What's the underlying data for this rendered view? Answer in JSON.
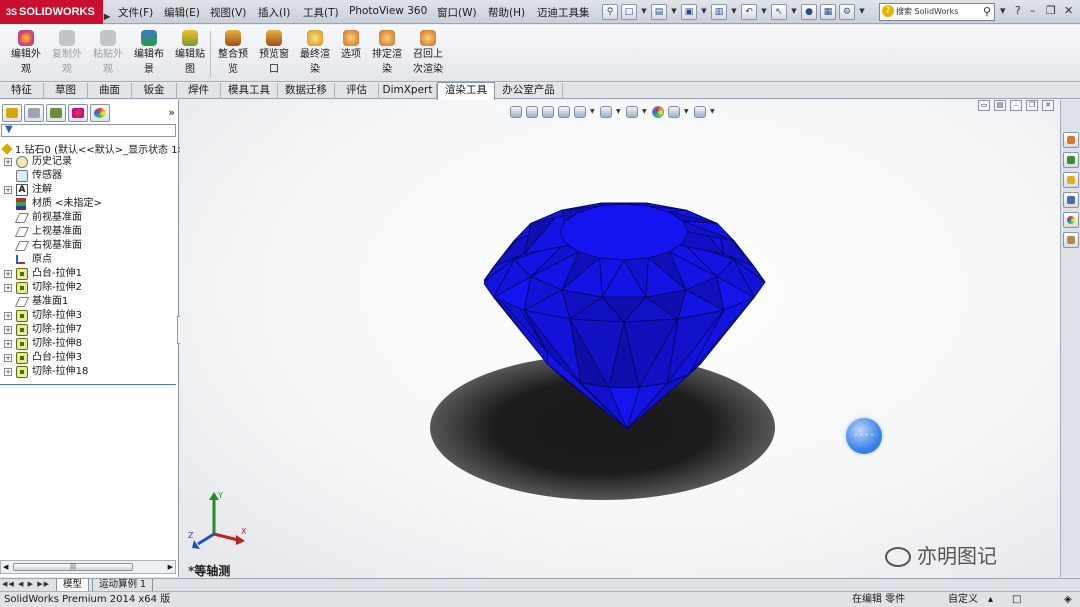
{
  "app": {
    "brand": "SOLIDWORKS",
    "brand_prefix": "3S",
    "menus": [
      "文件(F)",
      "编辑(E)",
      "视图(V)",
      "插入(I)",
      "工具(T)",
      "PhotoView 360",
      "窗口(W)",
      "帮助(H)",
      "迈迪工具集"
    ],
    "search_placeholder": "搜索 SolidWorks",
    "search_help_icon": "?"
  },
  "toolbar": {
    "buttons": [
      {
        "label_1": "编辑外",
        "label_2": "观",
        "enabled": true,
        "icon": "edit-appearance-icon",
        "color": "#e23a6a"
      },
      {
        "label_1": "复制外",
        "label_2": "观",
        "enabled": false,
        "icon": "copy-appearance-icon",
        "color": "#a6adb6"
      },
      {
        "label_1": "粘贴外",
        "label_2": "观",
        "enabled": false,
        "icon": "paste-appearance-icon",
        "color": "#a6adb6"
      },
      {
        "label_1": "编辑布",
        "label_2": "景",
        "enabled": true,
        "icon": "edit-scene-icon",
        "color": "#3a7ad0"
      },
      {
        "label_1": "编辑贴",
        "label_2": "图",
        "enabled": true,
        "icon": "edit-decal-icon",
        "color": "#d8a020"
      },
      {
        "label_1": "整合预",
        "label_2": "览",
        "enabled": true,
        "icon": "integrated-preview-icon",
        "color": "#c86a2a"
      },
      {
        "label_1": "预览窗",
        "label_2": "口",
        "enabled": true,
        "icon": "preview-window-icon",
        "color": "#c86a2a"
      },
      {
        "label_1": "最终渲",
        "label_2": "染",
        "enabled": true,
        "icon": "final-render-icon",
        "color": "#d0901a"
      },
      {
        "label_1": "选项",
        "label_2": "",
        "enabled": true,
        "icon": "options-icon",
        "color": "#c86a2a"
      },
      {
        "label_1": "排定渲",
        "label_2": "染",
        "enabled": true,
        "icon": "schedule-render-icon",
        "color": "#c86a2a"
      },
      {
        "label_1": "召回上",
        "label_2": "次渲染",
        "enabled": true,
        "icon": "recall-last-render-icon",
        "color": "#c86a2a"
      }
    ]
  },
  "tabs": [
    "特征",
    "草图",
    "曲面",
    "钣金",
    "焊件",
    "模具工具",
    "数据迁移",
    "评估",
    "DimXpert",
    "渲染工具",
    "办公室产品"
  ],
  "active_tab": "渲染工具",
  "feature_tree": {
    "root": "1.钻石0 (默认<<默认>_显示状态 1>",
    "items": [
      {
        "label": "历史记录",
        "icon": "history-icon",
        "expandable": true
      },
      {
        "label": "传感器",
        "icon": "sensor-icon",
        "expandable": false
      },
      {
        "label": "注解",
        "icon": "annotation-icon",
        "expandable": true
      },
      {
        "label": "材质 <未指定>",
        "icon": "material-icon",
        "expandable": false
      },
      {
        "label": "前视基准面",
        "icon": "plane-icon",
        "expandable": false
      },
      {
        "label": "上视基准面",
        "icon": "plane-icon",
        "expandable": false
      },
      {
        "label": "右视基准面",
        "icon": "plane-icon",
        "expandable": false
      },
      {
        "label": "原点",
        "icon": "origin-icon",
        "expandable": false
      },
      {
        "label": "凸台-拉伸1",
        "icon": "extrude-feature-icon",
        "expandable": true
      },
      {
        "label": "切除-拉伸2",
        "icon": "cut-feature-icon",
        "expandable": true
      },
      {
        "label": "基准面1",
        "icon": "plane-icon",
        "expandable": false
      },
      {
        "label": "切除-拉伸3",
        "icon": "cut-feature-icon",
        "expandable": true
      },
      {
        "label": "切除-拉伸7",
        "icon": "cut-feature-icon",
        "expandable": true
      },
      {
        "label": "切除-拉伸8",
        "icon": "cut-feature-icon",
        "expandable": true
      },
      {
        "label": "凸台-拉伸3",
        "icon": "extrude-feature-icon",
        "expandable": true
      },
      {
        "label": "切除-拉伸18",
        "icon": "cut-feature-icon",
        "expandable": true
      }
    ]
  },
  "viewport": {
    "view_label": "*等轴测",
    "gem_color": "#1414f0",
    "triad_labels": {
      "y": "Y",
      "x": "X",
      "z": "Z"
    }
  },
  "watermark": "亦明图记",
  "bottom_tabs": [
    "模型",
    "运动算例 1"
  ],
  "active_bottom_tab": "模型",
  "status": {
    "product": "SolidWorks Premium 2014 x64 版",
    "mode": "在编辑 零件",
    "custom": "自定义"
  }
}
